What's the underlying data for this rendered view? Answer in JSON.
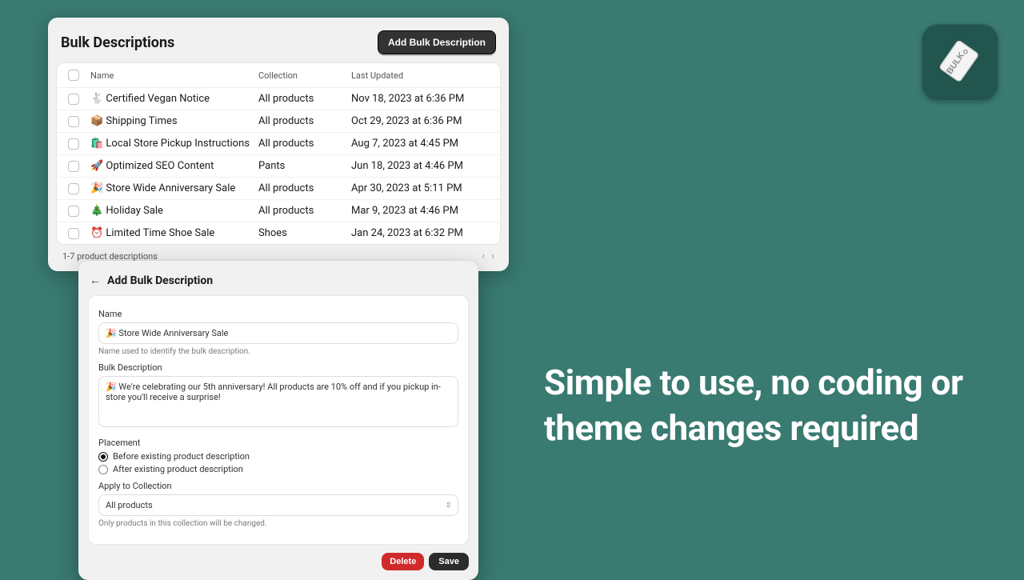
{
  "marketing": {
    "headline": "Simple to use, no coding or theme changes required"
  },
  "appIcon": {
    "label": "BULK"
  },
  "list": {
    "title": "Bulk Descriptions",
    "addButton": "Add Bulk Description",
    "columns": [
      "Name",
      "Collection",
      "Last Updated"
    ],
    "rows": [
      {
        "name": "🐇 Certified Vegan Notice",
        "collection": "All products",
        "updated": "Nov 18, 2023 at 6:36 PM"
      },
      {
        "name": "📦 Shipping Times",
        "collection": "All products",
        "updated": "Oct 29, 2023 at 6:36 PM"
      },
      {
        "name": "🛍️ Local Store Pickup Instructions",
        "collection": "All products",
        "updated": "Aug 7, 2023 at 4:45 PM"
      },
      {
        "name": "🚀 Optimized SEO Content",
        "collection": "Pants",
        "updated": "Jun 18, 2023 at 4:46 PM"
      },
      {
        "name": "🎉 Store Wide Anniversary Sale",
        "collection": "All products",
        "updated": "Apr 30, 2023 at 5:11 PM"
      },
      {
        "name": "🎄 Holiday Sale",
        "collection": "All products",
        "updated": "Mar 9, 2023 at 4:46 PM"
      },
      {
        "name": "⏰ Limited Time Shoe Sale",
        "collection": "Shoes",
        "updated": "Jan 24, 2023 at 6:32 PM"
      }
    ],
    "footer": "1-7 product descriptions"
  },
  "form": {
    "title": "Add Bulk Description",
    "nameLabel": "Name",
    "nameValue": "🎉 Store Wide Anniversary Sale",
    "nameHelp": "Name used to identify the bulk description.",
    "descLabel": "Bulk Description",
    "descValue": "🎉 We're celebrating our 5th anniversary! All products are 10% off and if you pickup in-store you'll receive a surprise!",
    "placementLabel": "Placement",
    "placementBefore": "Before existing product description",
    "placementAfter": "After existing product description",
    "collectionLabel": "Apply to Collection",
    "collectionValue": "All products",
    "collectionHelp": "Only products in this collection will be changed.",
    "delete": "Delete",
    "save": "Save"
  }
}
